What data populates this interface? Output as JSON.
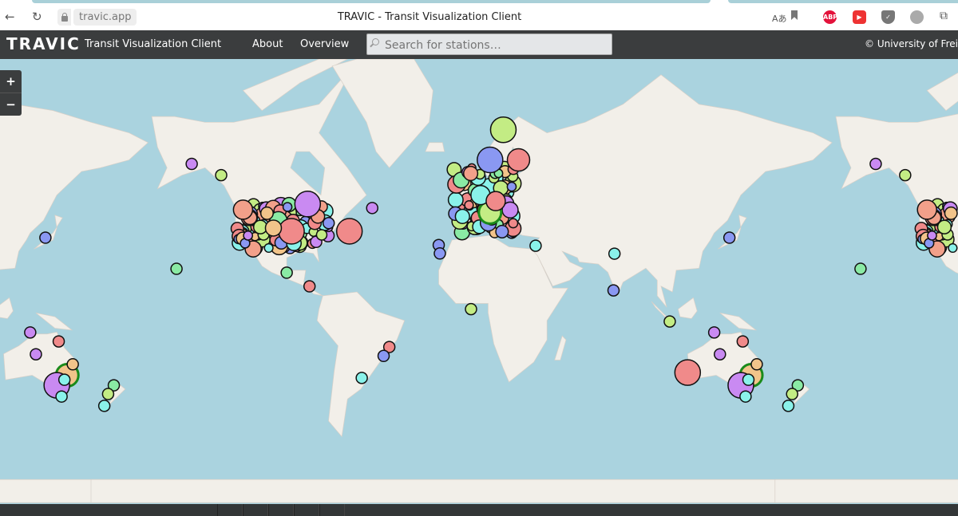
{
  "browser": {
    "url": "travic.app",
    "page_title": "TRAVIC - Transit Visualization Client",
    "extensions": [
      "translate-icon",
      "bookmark-icon",
      "adblock-plus-icon",
      "youtube-icon",
      "shield-icon",
      "globe-icon",
      "puzzle-icon"
    ],
    "abp_label": "ABP"
  },
  "nav": {
    "brand": "TRAVIC",
    "subtitle": "Transit Visualization Client",
    "links": [
      "About",
      "Overview"
    ],
    "search_placeholder": "Search for stations…",
    "copyright": "© University of Freiburg"
  },
  "zoom": {
    "in": "+",
    "out": "−"
  },
  "colors": {
    "ocean": "#aad3df",
    "land": "#f2efe9",
    "navbar": "#3b3d3e",
    "marker_palette": [
      "#f08a8a",
      "#c3ec84",
      "#8a98f2",
      "#c98af2",
      "#f2c48a",
      "#8af2ea",
      "#8aeaa4",
      "#f2a08a"
    ]
  },
  "stations": [
    [
      -147,
      61,
      7,
      3
    ],
    [
      -131.5,
      58,
      7,
      1
    ],
    [
      -155,
      21.7,
      7,
      6
    ],
    [
      -97,
      19.8,
      7,
      6
    ],
    [
      -85,
      12.9,
      7,
      0
    ],
    [
      -52,
      47.6,
      7,
      3
    ],
    [
      -64,
      38.7,
      16,
      0
    ],
    [
      -86,
      49,
      16,
      3
    ],
    [
      -94.5,
      38.7,
      16,
      0
    ],
    [
      -43,
      -18.6,
      7,
      0
    ],
    [
      -46,
      -23,
      7,
      2
    ],
    [
      -57.5,
      -33.2,
      7,
      5
    ],
    [
      0,
      1,
      7,
      1
    ],
    [
      -17,
      32.8,
      7,
      2
    ],
    [
      -16.4,
      29,
      7,
      2
    ],
    [
      34,
      32.5,
      7,
      5
    ],
    [
      17,
      68.6,
      16,
      1
    ],
    [
      10,
      62,
      16,
      2
    ],
    [
      25,
      62,
      14,
      0
    ],
    [
      75,
      10.8,
      7,
      2
    ],
    [
      75.5,
      28.9,
      7,
      5
    ],
    [
      136,
      36,
      7,
      2
    ],
    [
      104.6,
      -5.5,
      7,
      1
    ],
    [
      128,
      -11.2,
      7,
      3
    ],
    [
      131,
      -22.2,
      7,
      3
    ],
    [
      143,
      -15.8,
      7,
      0
    ],
    [
      114,
      -30.8,
      16,
      0
    ],
    [
      147.5,
      -32,
      14,
      4
    ],
    [
      150.4,
      -27,
      7,
      4
    ],
    [
      142,
      -36.4,
      16,
      3
    ],
    [
      146,
      -34,
      7,
      5
    ],
    [
      144.5,
      -41,
      7,
      5
    ],
    [
      172,
      -36.4,
      7,
      6
    ],
    [
      169,
      -40,
      7,
      1
    ],
    [
      167,
      -44.6,
      7,
      5
    ],
    [
      10,
      46,
      14,
      1
    ],
    [
      5,
      52,
      12,
      5
    ],
    [
      13,
      50,
      12,
      0
    ],
    [
      -120,
      47,
      12,
      7
    ],
    [
      -104,
      40,
      10,
      4
    ]
  ]
}
